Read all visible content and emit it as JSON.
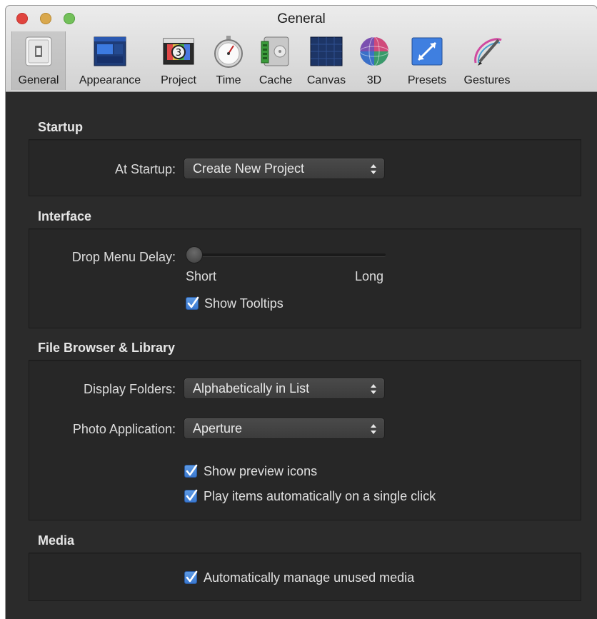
{
  "window": {
    "title": "General"
  },
  "toolbar": {
    "items": [
      {
        "label": "General",
        "icon": "general-switch-icon",
        "selected": true
      },
      {
        "label": "Appearance",
        "icon": "appearance-icon"
      },
      {
        "label": "Project",
        "icon": "project-clapper-icon"
      },
      {
        "label": "Time",
        "icon": "stopwatch-icon"
      },
      {
        "label": "Cache",
        "icon": "cache-drive-icon"
      },
      {
        "label": "Canvas",
        "icon": "canvas-grid-icon"
      },
      {
        "label": "3D",
        "icon": "sphere-3d-icon"
      },
      {
        "label": "Presets",
        "icon": "presets-arrows-icon"
      },
      {
        "label": "Gestures",
        "icon": "gestures-pen-icon"
      }
    ]
  },
  "startup": {
    "title": "Startup",
    "at_startup_label": "At Startup:",
    "at_startup_value": "Create New Project"
  },
  "interface": {
    "title": "Interface",
    "drop_menu_delay_label": "Drop Menu Delay:",
    "slider_min_label": "Short",
    "slider_max_label": "Long",
    "slider_value": 0.0,
    "show_tooltips_label": "Show Tooltips",
    "show_tooltips_checked": true
  },
  "file_browser": {
    "title": "File Browser & Library",
    "display_folders_label": "Display Folders:",
    "display_folders_value": "Alphabetically in List",
    "photo_app_label": "Photo Application:",
    "photo_app_value": "Aperture",
    "show_preview_label": "Show preview icons",
    "show_preview_checked": true,
    "play_items_label": "Play items automatically on a single click",
    "play_items_checked": true
  },
  "media": {
    "title": "Media",
    "auto_manage_label": "Automatically manage unused media",
    "auto_manage_checked": true
  },
  "colors": {
    "background": "#2b2b2b",
    "checkbox_accent": "#3a78cf"
  }
}
